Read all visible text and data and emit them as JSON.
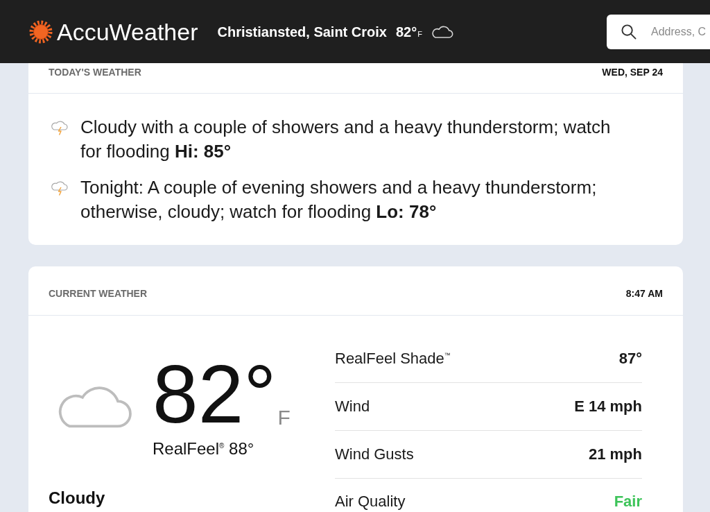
{
  "header": {
    "logo": "AccuWeather",
    "location": "Christiansted, Saint Croix",
    "temperature": "82°",
    "unit": "F",
    "search": {
      "placeholder": "Address, C"
    }
  },
  "today": {
    "title": "TODAY'S WEATHER",
    "date": "WED, SEP 24",
    "forecasts": [
      "Cloudy with a couple of showers and a heavy thunderstorm; watch for flooding **Hi: 85°**",
      "Tonight: A couple of evening showers and a heavy thunderstorm; otherwise, cloudy; watch for flooding **Lo: 78°**"
    ]
  },
  "current": {
    "title": "CURRENT WEATHER",
    "time": "8:47 AM",
    "temperature": "82°",
    "unit": "F",
    "realfeel": "RealFeel$^{®}$ 88°",
    "condition": "Cloudy",
    "details": [
      {
        "label": "RealFeel Shade$^{™}$",
        "value": "87°",
        "color": "#1a1a1a"
      },
      {
        "label": "Wind",
        "value": "E 14 mph",
        "color": "#1a1a1a"
      },
      {
        "label": "Wind Gusts",
        "value": "21 mph",
        "color": "#1a1a1a"
      },
      {
        "label": "Air Quality",
        "value": "Fair",
        "color": "#3ec45a"
      }
    ]
  }
}
